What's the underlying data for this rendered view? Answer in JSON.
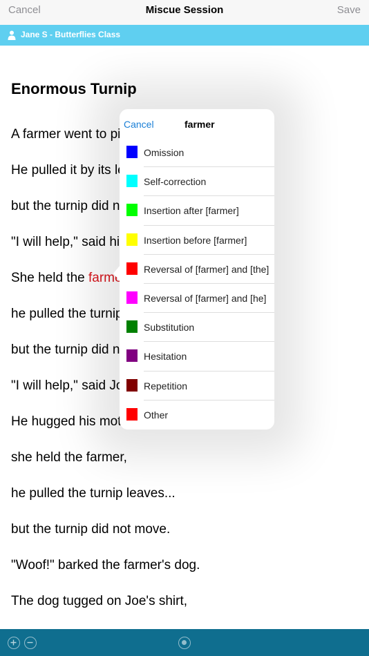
{
  "nav": {
    "cancel": "Cancel",
    "title": "Miscue Session",
    "save": "Save"
  },
  "student": {
    "label": "Jane S - Butterflies Class"
  },
  "story": {
    "title": "Enormous Turnip",
    "lines": [
      "A farmer went to pick",
      "He pulled it by its leav",
      "but the turnip did not",
      "\"I will help,\" said his w",
      "",
      "he pulled the turnip le",
      "but the turnip did not",
      "\"I will help,\" said Joe.",
      "He hugged his mothe",
      "she held the farmer,",
      "he pulled the turnip leaves...",
      "but the turnip did not move.",
      "\"Woof!\" barked the farmer's dog.",
      "The dog tugged on Joe's shirt,"
    ],
    "line5_prefix": "She held the ",
    "line5_word": "farmer",
    "line5_suffix": ","
  },
  "popover": {
    "cancel": "Cancel",
    "word": "farmer",
    "items": [
      {
        "label": "Omission",
        "color": "#0000ff"
      },
      {
        "label": "Self-correction",
        "color": "#00ffff"
      },
      {
        "label": "Insertion after [farmer]",
        "color": "#00ff00"
      },
      {
        "label": "Insertion before [farmer]",
        "color": "#ffff00"
      },
      {
        "label": "Reversal of [farmer] and [the]",
        "color": "#ff0000"
      },
      {
        "label": "Reversal of [farmer] and [he]",
        "color": "#ff00ff"
      },
      {
        "label": "Substitution",
        "color": "#008000"
      },
      {
        "label": "Hesitation",
        "color": "#800080"
      },
      {
        "label": "Repetition",
        "color": "#800000"
      },
      {
        "label": "Other",
        "color": "#ff0000"
      }
    ]
  },
  "toolbar": {
    "zoom_in_icon": "plus-circle-icon",
    "zoom_out_icon": "minus-circle-icon",
    "record_icon": "record-icon"
  },
  "colors": {
    "accent_bar": "#5fcff0",
    "toolbar": "#0f6e8f",
    "highlight": "#d9141b",
    "link": "#1a7fd6"
  }
}
